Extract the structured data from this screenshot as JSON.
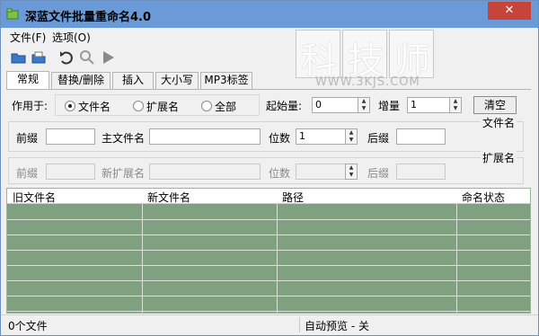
{
  "window": {
    "title": "深蓝文件批量重命名4.0",
    "controls": {
      "minimize": "—",
      "maximize": "□",
      "close": "✕"
    }
  },
  "menu": [
    {
      "label": "文件(F)"
    },
    {
      "label": "选项(O)"
    }
  ],
  "toolbar": {
    "icons": [
      "open-folder-icon",
      "open-files-icon",
      "undo-icon",
      "preview-search-icon",
      "run-icon"
    ]
  },
  "watermark": {
    "chars": [
      "科",
      "技",
      "师"
    ],
    "url": "WWW.3KJS.COM"
  },
  "tabs": [
    {
      "label": "常规",
      "active": true
    },
    {
      "label": "替换/删除"
    },
    {
      "label": "插入"
    },
    {
      "label": "大小写"
    },
    {
      "label": "MP3标签"
    }
  ],
  "general": {
    "apply_to_label": "作用于:",
    "radio_options": [
      {
        "label": "文件名",
        "checked": true
      },
      {
        "label": "扩展名",
        "checked": false
      },
      {
        "label": "全部",
        "checked": false
      }
    ],
    "start_label": "起始量:",
    "start_value": "0",
    "increment_label": "增量",
    "increment_value": "1",
    "clear_button": "清空"
  },
  "filename_group": {
    "title": "文件名",
    "prefix_label": "前缀",
    "prefix_value": "",
    "main_label": "主文件名",
    "main_value": "",
    "digits_label": "位数",
    "digits_value": "1",
    "suffix_label": "后缀",
    "suffix_value": ""
  },
  "extension_group": {
    "title": "扩展名",
    "prefix_label": "前缀",
    "main_label": "新扩展名",
    "digits_label": "位数",
    "suffix_label": "后缀"
  },
  "table": {
    "columns": [
      "旧文件名",
      "新文件名",
      "路径",
      "命名状态"
    ],
    "rows": []
  },
  "status": {
    "file_count": "0个文件",
    "auto_preview": "自动预览 - 关"
  },
  "colors": {
    "titlebar": "#6a9bd8",
    "grid_bg": "#7fa17f",
    "close_button": "#c7443a"
  }
}
